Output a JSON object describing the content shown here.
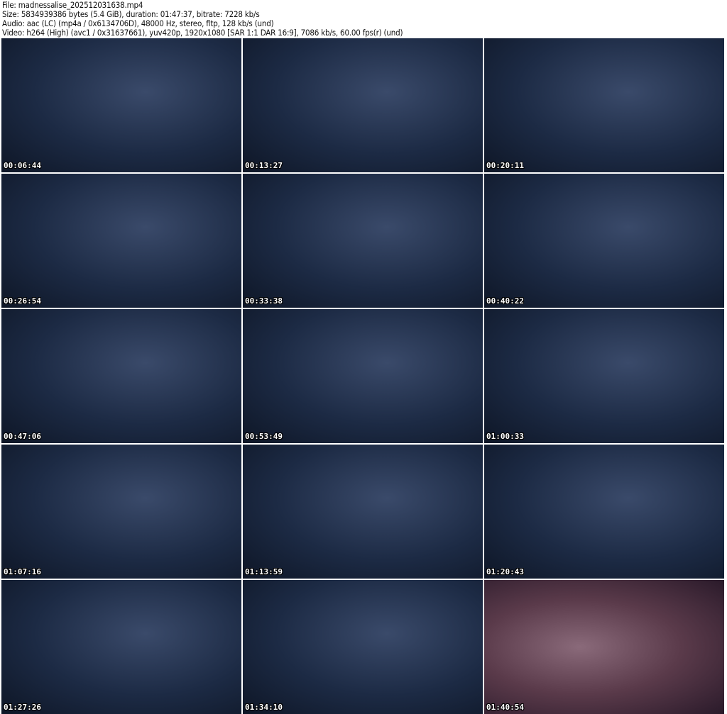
{
  "header": {
    "file": "File: madnessalise_202512031638.mp4",
    "size": "Size: 5834939386 bytes (5.4 GiB), duration: 01:47:37, bitrate: 7228 kb/s",
    "audio": "Audio: aac (LC) (mp4a / 0x6134706D), 48000 Hz, stereo, fltp, 128 kb/s (und)",
    "video": "Video: h264 (High) (avc1 / 0x31637661), yuv420p, 1920x1080 [SAR 1:1 DAR 16:9], 7086 kb/s, 60.00 fps(r) (und)"
  },
  "thumbnails": [
    {
      "timestamp": "00:06:44"
    },
    {
      "timestamp": "00:13:27"
    },
    {
      "timestamp": "00:20:11"
    },
    {
      "timestamp": "00:26:54"
    },
    {
      "timestamp": "00:33:38"
    },
    {
      "timestamp": "00:40:22"
    },
    {
      "timestamp": "00:47:06"
    },
    {
      "timestamp": "00:53:49"
    },
    {
      "timestamp": "01:00:33"
    },
    {
      "timestamp": "01:07:16"
    },
    {
      "timestamp": "01:13:59"
    },
    {
      "timestamp": "01:20:43"
    },
    {
      "timestamp": "01:27:26"
    },
    {
      "timestamp": "01:34:10"
    },
    {
      "timestamp": "01:40:54"
    }
  ]
}
